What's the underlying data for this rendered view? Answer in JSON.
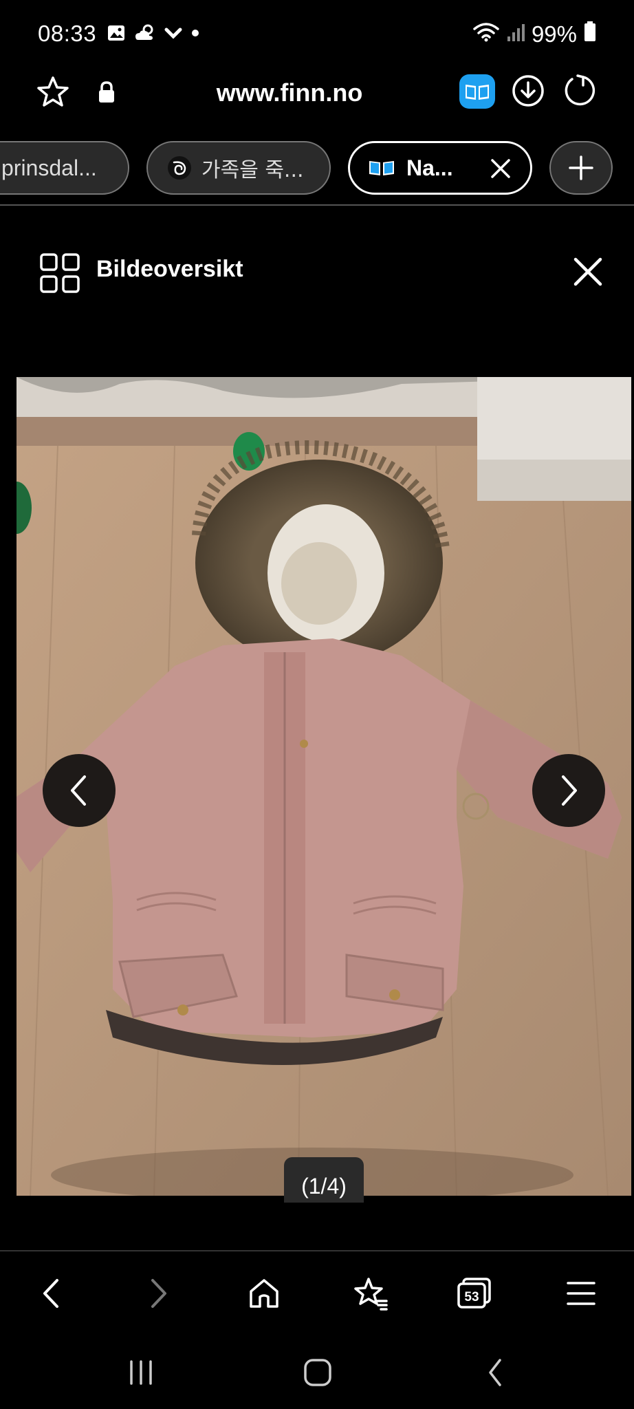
{
  "status": {
    "time": "08:33",
    "battery": "99%",
    "icons": [
      "gallery-icon",
      "weather-icon",
      "download-arrow-icon",
      "dot-icon",
      "wifi-icon",
      "signal-icon",
      "battery-icon"
    ]
  },
  "address_bar": {
    "url": "www.finn.no",
    "icons": [
      "bookmark-star-icon",
      "lock-icon",
      "reader-mode-icon",
      "download-icon",
      "reload-icon"
    ]
  },
  "tabs": [
    {
      "label": "prinsdal...",
      "active": false
    },
    {
      "label": "가족을 죽...",
      "active": false
    },
    {
      "label": "Na...",
      "active": true
    }
  ],
  "gallery": {
    "title": "Bildeoversikt",
    "counter": "(1/4)"
  },
  "colors": {
    "background": "#000000",
    "accent_blue": "#1e90ff",
    "jacket_pink": "#c89a94"
  }
}
